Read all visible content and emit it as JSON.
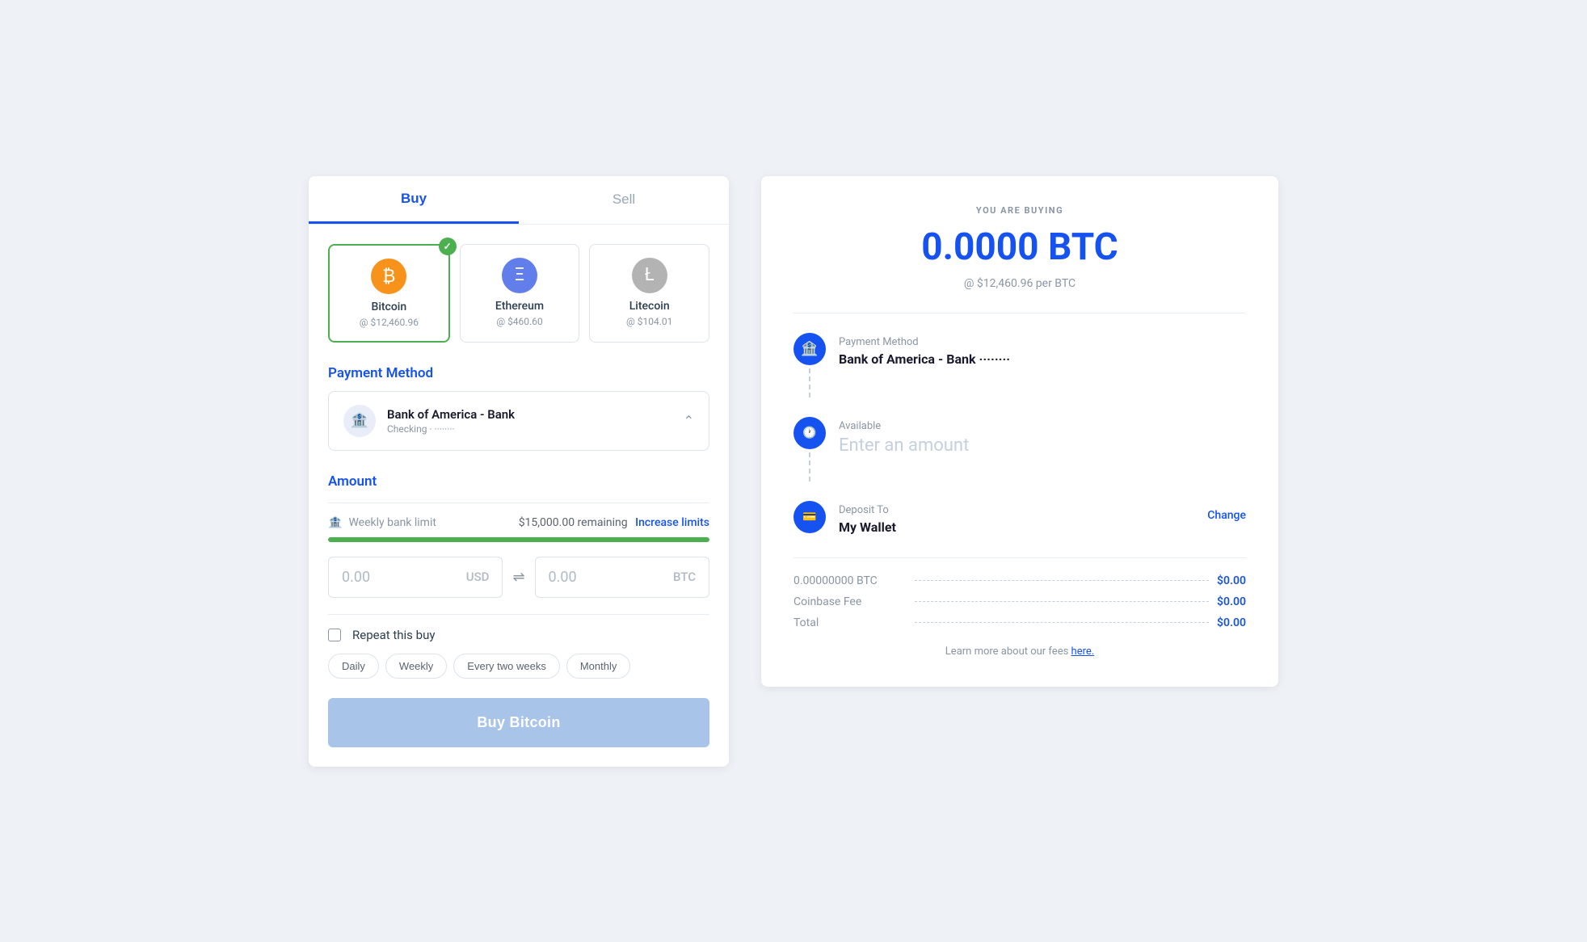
{
  "tabs": [
    {
      "id": "buy",
      "label": "Buy",
      "active": true
    },
    {
      "id": "sell",
      "label": "Sell",
      "active": false
    }
  ],
  "crypto_cards": [
    {
      "id": "bitcoin",
      "name": "Bitcoin",
      "price": "@ $12,460.96",
      "icon": "₿",
      "type": "bitcoin",
      "selected": true
    },
    {
      "id": "ethereum",
      "name": "Ethereum",
      "price": "@ $460.60",
      "icon": "⬡",
      "type": "ethereum",
      "selected": false
    },
    {
      "id": "litecoin",
      "name": "Litecoin",
      "price": "@ $104.01",
      "icon": "Ł",
      "type": "litecoin",
      "selected": false
    }
  ],
  "payment_method": {
    "section_label": "Payment Method",
    "bank_name": "Bank of America - Bank",
    "account_type": "Checking · ········"
  },
  "amount": {
    "section_label": "Amount",
    "limit_label": "Weekly bank limit",
    "limit_remaining": "$15,000.00 remaining",
    "limit_link": "Increase limits",
    "progress_percent": 100,
    "usd_value": "0.00",
    "usd_currency": "USD",
    "btc_value": "0.00",
    "btc_currency": "BTC"
  },
  "repeat": {
    "label": "Repeat this buy",
    "options": [
      "Daily",
      "Weekly",
      "Every two weeks",
      "Monthly"
    ]
  },
  "buy_button": {
    "label": "Buy Bitcoin"
  },
  "receipt": {
    "you_are_buying_label": "YOU ARE BUYING",
    "btc_amount": "0.0000 BTC",
    "btc_price": "@ $12,460.96 per BTC",
    "payment_method_label": "Payment Method",
    "payment_method_value": "Bank of America - Bank ········",
    "available_label": "Available",
    "available_placeholder": "Enter an amount",
    "deposit_label": "Deposit To",
    "deposit_value": "My Wallet",
    "deposit_change": "Change",
    "totals": [
      {
        "label": "0.00000000 BTC",
        "value": "$0.00"
      },
      {
        "label": "Coinbase Fee",
        "value": "$0.00"
      },
      {
        "label": "Total",
        "value": "$0.00"
      }
    ],
    "learn_more": "Learn more about our fees",
    "learn_more_link": "here."
  }
}
